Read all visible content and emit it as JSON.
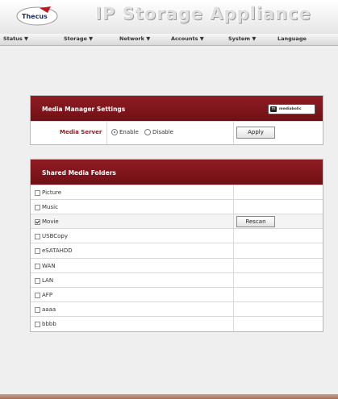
{
  "app": {
    "brand": "Thecus",
    "title": "IP Storage Appliance"
  },
  "nav": [
    {
      "label": "Status ▼"
    },
    {
      "label": "Storage ▼"
    },
    {
      "label": "Network ▼"
    },
    {
      "label": "Accounts ▼"
    },
    {
      "label": "System ▼"
    },
    {
      "label": "Language"
    }
  ],
  "media_manager": {
    "title": "Media Manager Settings",
    "logo_text": "mediabolic",
    "server_label": "Media Server",
    "enable_label": "Enable",
    "disable_label": "Disable",
    "selected": "Enable",
    "apply_label": "Apply"
  },
  "shared": {
    "title": "Shared Media Folders",
    "rescan_label": "Rescan",
    "folders": [
      {
        "name": "Picture",
        "checked": false
      },
      {
        "name": "Music",
        "checked": false
      },
      {
        "name": "Movie",
        "checked": true
      },
      {
        "name": "USBCopy",
        "checked": false
      },
      {
        "name": "eSATAHDD",
        "checked": false
      },
      {
        "name": "WAN",
        "checked": false
      },
      {
        "name": "LAN",
        "checked": false
      },
      {
        "name": "AFP",
        "checked": false
      },
      {
        "name": "aaaa",
        "checked": false
      },
      {
        "name": "bbbb",
        "checked": false
      }
    ]
  },
  "colors": {
    "panel_header": "#7e151b",
    "accent": "#2a6fb0"
  }
}
